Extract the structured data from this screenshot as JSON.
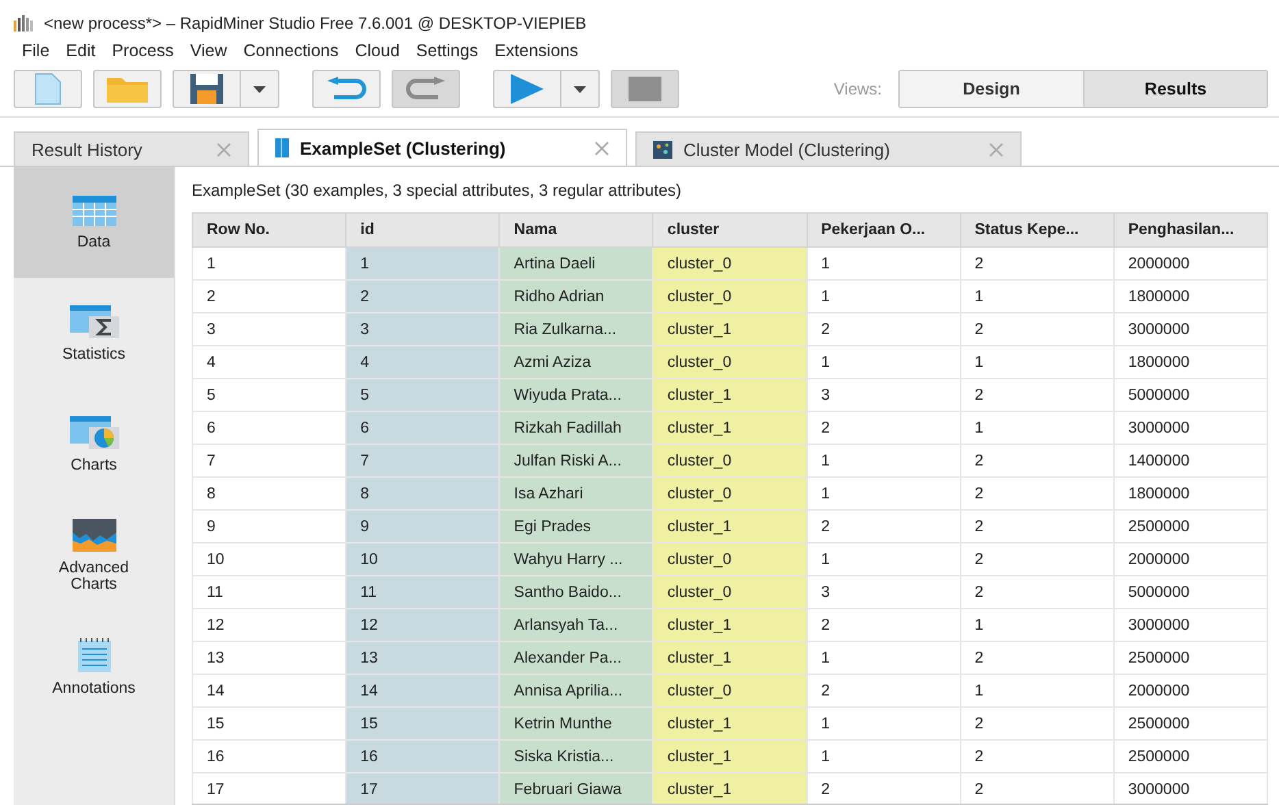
{
  "window": {
    "title": "<new process*> – RapidMiner Studio Free 7.6.001 @ DESKTOP-VIEPIEB"
  },
  "menu": [
    "File",
    "Edit",
    "Process",
    "View",
    "Connections",
    "Cloud",
    "Settings",
    "Extensions"
  ],
  "toolbar": {
    "buttons": [
      {
        "kind": "new",
        "disabled": false,
        "dropdown": false
      },
      {
        "kind": "open",
        "disabled": false,
        "dropdown": false
      },
      {
        "kind": "save",
        "disabled": false,
        "dropdown": true
      },
      {
        "kind": "undo",
        "disabled": false,
        "dropdown": false
      },
      {
        "kind": "redo",
        "disabled": true,
        "dropdown": false
      },
      {
        "kind": "run",
        "disabled": false,
        "dropdown": true
      },
      {
        "kind": "stop",
        "disabled": true,
        "dropdown": false
      }
    ],
    "views_label": "Views:",
    "views": [
      {
        "label": "Design",
        "selected": false
      },
      {
        "label": "Results",
        "selected": true
      }
    ]
  },
  "tabs": [
    {
      "label": "Result History",
      "kind": "history",
      "selected": false
    },
    {
      "label": "ExampleSet (Clustering)",
      "kind": "exampleset",
      "selected": true
    },
    {
      "label": "Cluster Model (Clustering)",
      "kind": "model",
      "selected": false
    }
  ],
  "sidebar": {
    "items": [
      {
        "label": "Data",
        "kind": "data",
        "selected": true
      },
      {
        "label": "Statistics",
        "kind": "statistics",
        "selected": false
      },
      {
        "label": "Charts",
        "kind": "charts",
        "selected": false
      },
      {
        "label": "Advanced Charts",
        "kind": "advanced",
        "selected": false
      },
      {
        "label": "Annotations",
        "kind": "annotations",
        "selected": false
      }
    ]
  },
  "table": {
    "caption": "ExampleSet (30 examples, 3 special attributes, 3 regular attributes)",
    "columns": [
      {
        "label": "Row No."
      },
      {
        "label": "id",
        "color": "#c8dae0"
      },
      {
        "label": "Nama",
        "color": "#c8dfce"
      },
      {
        "label": "cluster",
        "color": "#eff0a2"
      },
      {
        "label": "Pekerjaan O..."
      },
      {
        "label": "Status Kepe..."
      },
      {
        "label": "Penghasilan..."
      }
    ],
    "rows": [
      [
        "1",
        "1",
        "Artina Daeli",
        "cluster_0",
        "1",
        "2",
        "2000000"
      ],
      [
        "2",
        "2",
        "Ridho Adrian",
        "cluster_0",
        "1",
        "1",
        "1800000"
      ],
      [
        "3",
        "3",
        "Ria Zulkarna...",
        "cluster_1",
        "2",
        "2",
        "3000000"
      ],
      [
        "4",
        "4",
        "Azmi Aziza",
        "cluster_0",
        "1",
        "1",
        "1800000"
      ],
      [
        "5",
        "5",
        "Wiyuda Prata...",
        "cluster_1",
        "3",
        "2",
        "5000000"
      ],
      [
        "6",
        "6",
        "Rizkah Fadillah",
        "cluster_1",
        "2",
        "1",
        "3000000"
      ],
      [
        "7",
        "7",
        "Julfan Riski A...",
        "cluster_0",
        "1",
        "2",
        "1400000"
      ],
      [
        "8",
        "8",
        "Isa Azhari",
        "cluster_0",
        "1",
        "2",
        "1800000"
      ],
      [
        "9",
        "9",
        "Egi Prades",
        "cluster_1",
        "2",
        "2",
        "2500000"
      ],
      [
        "10",
        "10",
        "Wahyu Harry ...",
        "cluster_0",
        "1",
        "2",
        "2000000"
      ],
      [
        "11",
        "11",
        "Santho Baido...",
        "cluster_0",
        "3",
        "2",
        "5000000"
      ],
      [
        "12",
        "12",
        "Arlansyah Ta...",
        "cluster_1",
        "2",
        "1",
        "3000000"
      ],
      [
        "13",
        "13",
        "Alexander Pa...",
        "cluster_1",
        "1",
        "2",
        "2500000"
      ],
      [
        "14",
        "14",
        "Annisa Aprilia...",
        "cluster_0",
        "2",
        "1",
        "2000000"
      ],
      [
        "15",
        "15",
        "Ketrin Munthe",
        "cluster_1",
        "1",
        "2",
        "2500000"
      ],
      [
        "16",
        "16",
        "Siska Kristia...",
        "cluster_1",
        "1",
        "2",
        "2500000"
      ],
      [
        "17",
        "17",
        "Februari Giawa",
        "cluster_1",
        "2",
        "2",
        "3000000"
      ]
    ]
  }
}
